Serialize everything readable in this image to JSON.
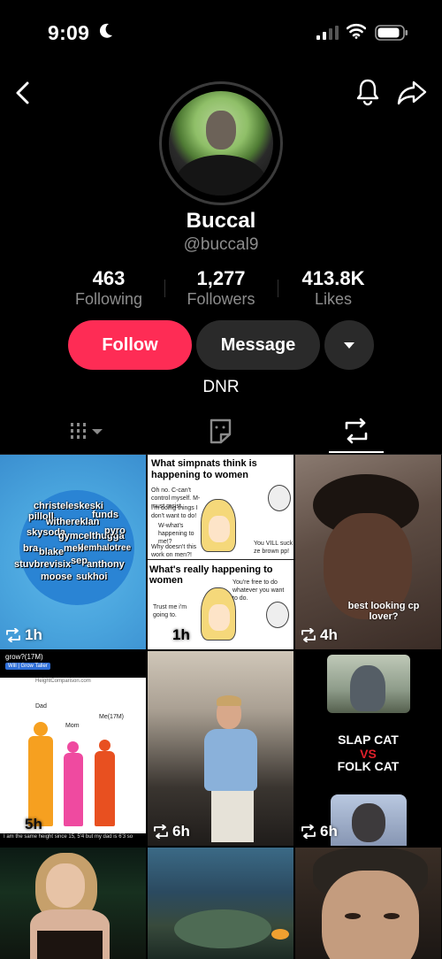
{
  "status_bar": {
    "time": "9:09"
  },
  "profile": {
    "display_name": "Buccal",
    "username": "@buccal9",
    "bio": "DNR"
  },
  "stats": [
    {
      "value": "463",
      "label": "Following"
    },
    {
      "value": "1,277",
      "label": "Followers"
    },
    {
      "value": "413.8K",
      "label": "Likes"
    }
  ],
  "actions": {
    "follow_label": "Follow",
    "message_label": "Message"
  },
  "tabs": [
    {
      "name": "videos",
      "icon": "grid-icon"
    },
    {
      "name": "favorites",
      "icon": "sticker-icon"
    },
    {
      "name": "reposts",
      "icon": "repost-icon",
      "active": true
    }
  ],
  "colors": {
    "accent": "#fe2c55",
    "secondary_btn": "#2a2a2a",
    "muted_text": "#8d8d8d"
  },
  "videos": [
    {
      "time": "1h",
      "names": [
        "christeleskeski",
        "pilloll",
        "withereklan",
        "funds",
        "skysoda",
        "gymcelthugga",
        "pyro",
        "bra",
        "blake",
        "mek",
        "lemhalotree",
        "stuvbrevisix",
        "sep",
        "anthony",
        "moose",
        "sukhoi"
      ]
    },
    {
      "time": "1h",
      "heading_top": "What simpnats think is happening to women",
      "left_top": "Oh no. C-can't control myself. M-must resist.",
      "left_mid": "I'm doing things I don't want to do!",
      "left_mid2": "W-what's happening to me!?",
      "left_bottom": "Why doesn't this work on men?!",
      "right_top": "You VILL suck ze brown pp!",
      "heading_bottom": "What's really happening to women",
      "bottom_left": "Trust me i'm going to.",
      "bottom_right": "You're free to do whatever you want to do."
    },
    {
      "time": "4h",
      "caption": "best looking cp lover?"
    },
    {
      "time": "5h",
      "top_text": "grow?(17M)",
      "badge": "Will | Grow Taller",
      "site": "HeightComparison.com",
      "label_dad": "Dad",
      "label_mom": "Mom",
      "label_me": "Me(17M)",
      "bottom_text": "I am the same height since 15, 5'4 but my dad is 6'3 so"
    },
    {
      "time": "6h"
    },
    {
      "time": "6h",
      "title_top": "SLAP CAT",
      "title_vs": "VS",
      "title_bottom": "FOLK CAT"
    },
    {
      "time": ""
    },
    {
      "time": ""
    },
    {
      "time": ""
    }
  ]
}
